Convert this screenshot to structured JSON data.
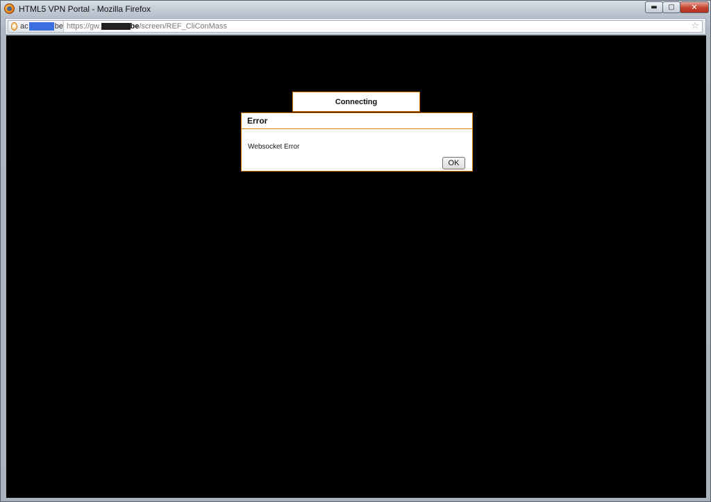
{
  "window": {
    "title": "HTML5 VPN Portal - Mozilla Firefox",
    "controls": {
      "minimize": "▬",
      "maximize": "▢",
      "close": "✕"
    }
  },
  "navbar": {
    "identity_prefix": "ac",
    "identity_suffix": "be",
    "url_prefix": "https://gw.",
    "url_host_tail": "be",
    "url_path": "/screen/REF_CliConMass",
    "bookmark_icon": "☆"
  },
  "content": {
    "connecting_label": "Connecting",
    "dialog": {
      "title": "Error",
      "message": "Websocket Error",
      "ok_label": "OK"
    }
  },
  "colors": {
    "accent_border": "#e07d00",
    "viewport_bg": "#000000"
  }
}
